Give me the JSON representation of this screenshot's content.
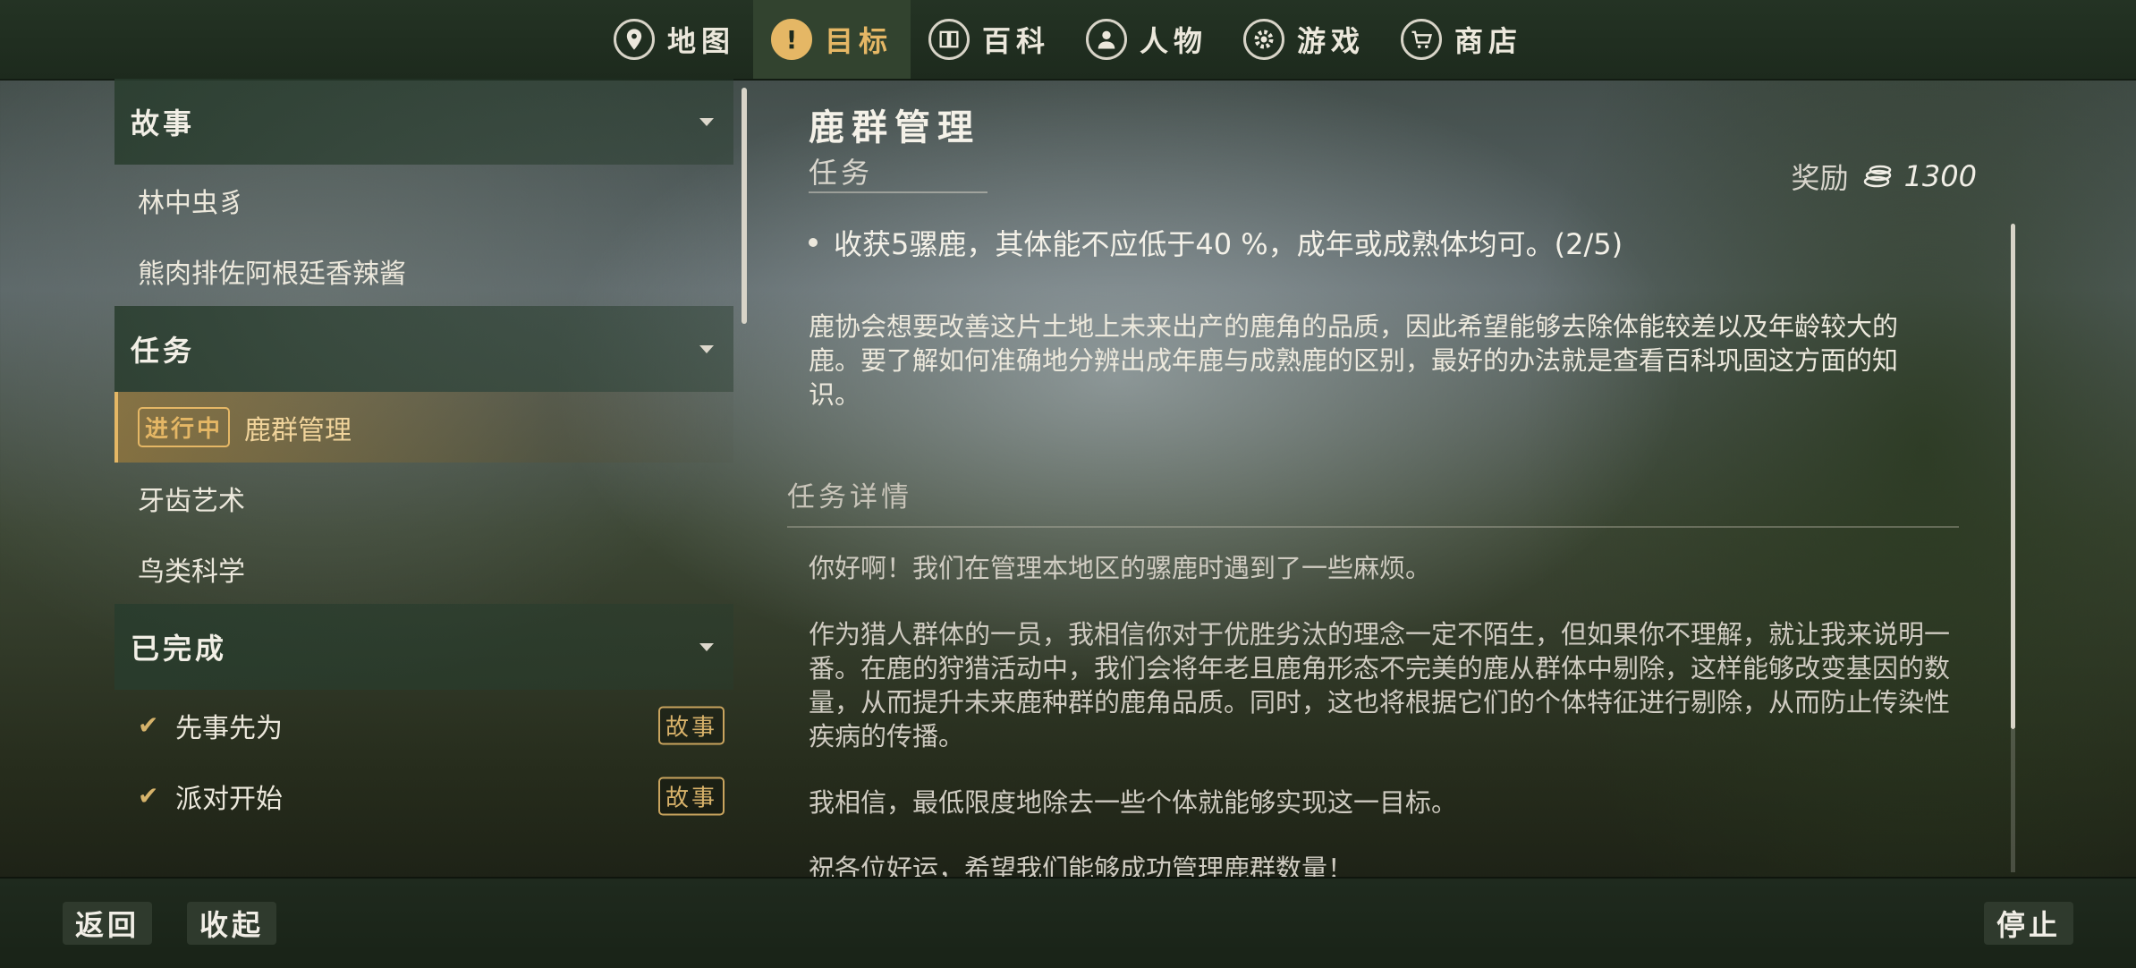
{
  "nav": {
    "tabs": [
      {
        "label": "地图",
        "icon": "map-pin-icon"
      },
      {
        "label": "目标",
        "icon": "exclamation-icon",
        "active": true
      },
      {
        "label": "百科",
        "icon": "book-icon"
      },
      {
        "label": "人物",
        "icon": "person-icon"
      },
      {
        "label": "游戏",
        "icon": "gear-icon"
      },
      {
        "label": "商店",
        "icon": "cart-icon"
      }
    ]
  },
  "sidebar": {
    "story": {
      "header": "故事",
      "items": [
        "林中虫豸",
        "熊肉排佐阿根廷香辣酱"
      ]
    },
    "missions": {
      "header": "任务",
      "items": [
        {
          "label": "鹿群管理",
          "badge": "进行中"
        },
        {
          "label": "牙齿艺术"
        },
        {
          "label": "鸟类科学"
        }
      ]
    },
    "completed": {
      "header": "已完成",
      "items": [
        {
          "label": "先事先为",
          "tag": "故事"
        },
        {
          "label": "派对开始",
          "tag": "故事"
        }
      ]
    }
  },
  "detail": {
    "title": "鹿群管理",
    "subtitle": "任务",
    "reward_label": "奖励",
    "reward_amount": "1300",
    "objective": "收获5骡鹿，其体能不应低于40 %，成年或成熟体均可。(2/5)",
    "description": "鹿协会想要改善这片土地上未来出产的鹿角的品质，因此希望能够去除体能较差以及年龄较大的鹿。要了解如何准确地分辨出成年鹿与成熟鹿的区别，最好的办法就是查看百科巩固这方面的知识。",
    "details_header": "任务详情",
    "letter": [
      "你好啊！我们在管理本地区的骡鹿时遇到了一些麻烦。",
      "作为猎人群体的一员，我相信你对于优胜劣汰的理念一定不陌生，但如果你不理解，就让我来说明一番。在鹿的狩猎活动中，我们会将年老且鹿角形态不完美的鹿从群体中剔除，这样能够改变基因的数量，从而提升未来鹿种群的鹿角品质。同时，这也将根据它们的个体特征进行剔除，从而防止传染性疾病的传播。",
      "我相信，最低限度地除去一些个体就能够实现这一目标。",
      "祝各位好运，希望我们能够成功管理鹿群数量！"
    ]
  },
  "bottom": {
    "back": "返回",
    "collapse": "收起",
    "stop": "停止"
  }
}
